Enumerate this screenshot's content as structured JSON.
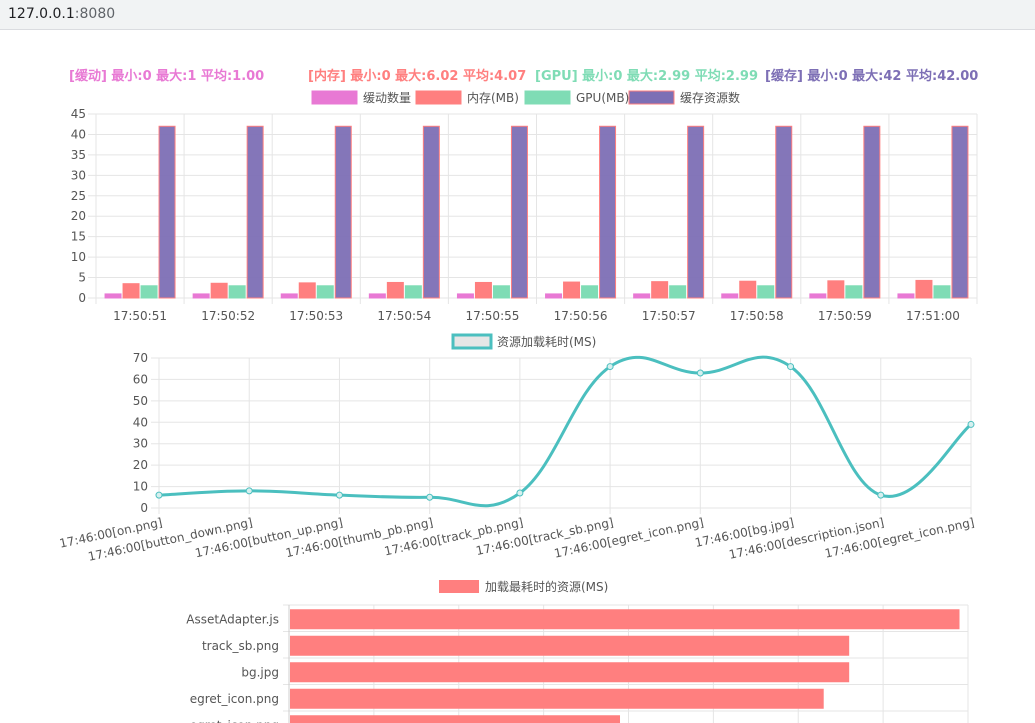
{
  "browser": {
    "host": "127.0.0.1",
    "port": ":8080"
  },
  "stats": [
    {
      "label": "[缓动] 最小:0 最大:1 平均:1.00",
      "color": "#e879d4"
    },
    {
      "label": "[内存] 最小:0 最大:6.02 平均:4.07",
      "color": "#ff7f7f"
    },
    {
      "label": "[GPU] 最小:0 最大:2.99 平均:2.99",
      "color": "#7fdcb5"
    },
    {
      "label": "[缓存] 最小:0 最大:42 平均:42.00",
      "color": "#7d6fb5"
    }
  ],
  "chart_data": [
    {
      "type": "bar",
      "title": "",
      "xlabel": "",
      "ylabel": "",
      "ylim": [
        0,
        45
      ],
      "ytick_step": 5,
      "legend_position": "top",
      "grid": true,
      "categories": [
        "17:50:51",
        "17:50:52",
        "17:50:53",
        "17:50:54",
        "17:50:55",
        "17:50:56",
        "17:50:57",
        "17:50:58",
        "17:50:59",
        "17:51:00"
      ],
      "series": [
        {
          "name": "缓动数量",
          "color": "#e879d4",
          "values": [
            1,
            1,
            1,
            1,
            1,
            1,
            1,
            1,
            1,
            1
          ]
        },
        {
          "name": "内存(MB)",
          "color": "#ff7f7f",
          "values": [
            3.5,
            3.6,
            3.7,
            3.8,
            3.8,
            3.9,
            4.0,
            4.1,
            4.2,
            4.3
          ]
        },
        {
          "name": "GPU(MB)",
          "color": "#7fdcb5",
          "values": [
            2.99,
            2.99,
            2.99,
            2.99,
            2.99,
            2.99,
            2.99,
            2.99,
            2.99,
            2.99
          ]
        },
        {
          "name": "缓存资源数",
          "color": "#7d6fb5",
          "values": [
            42,
            42,
            42,
            42,
            42,
            42,
            42,
            42,
            42,
            42
          ]
        }
      ]
    },
    {
      "type": "line",
      "title": "",
      "xlabel": "",
      "ylabel": "",
      "ylim": [
        0,
        70
      ],
      "ytick_step": 10,
      "legend_position": "top",
      "grid": true,
      "categories": [
        "17:46:00[on.png]",
        "17:46:00[button_down.png]",
        "17:46:00[button_up.png]",
        "17:46:00[thumb_pb.png]",
        "17:46:00[track_pb.png]",
        "17:46:00[track_sb.png]",
        "17:46:00[egret_icon.png]",
        "17:46:00[bg.jpg]",
        "17:46:00[description.json]",
        "17:46:00[egret_icon.png]"
      ],
      "series": [
        {
          "name": "资源加载耗时(MS)",
          "color": "#4bbfbf",
          "values": [
            6,
            8,
            6,
            5,
            7,
            66,
            63,
            66,
            6,
            39
          ]
        }
      ]
    },
    {
      "type": "bar",
      "orientation": "horizontal",
      "title": "",
      "xlabel": "",
      "ylabel": "",
      "legend_position": "top",
      "grid": true,
      "xlim": [
        0,
        80
      ],
      "categories": [
        "AssetAdapter.js",
        "track_sb.png",
        "bg.jpg",
        "egret_icon.png",
        "egret_icon.png"
      ],
      "series": [
        {
          "name": "加载最耗时的资源(MS)",
          "color": "#ff7f7f",
          "values": [
            79,
            66,
            66,
            63,
            39
          ]
        }
      ]
    }
  ]
}
